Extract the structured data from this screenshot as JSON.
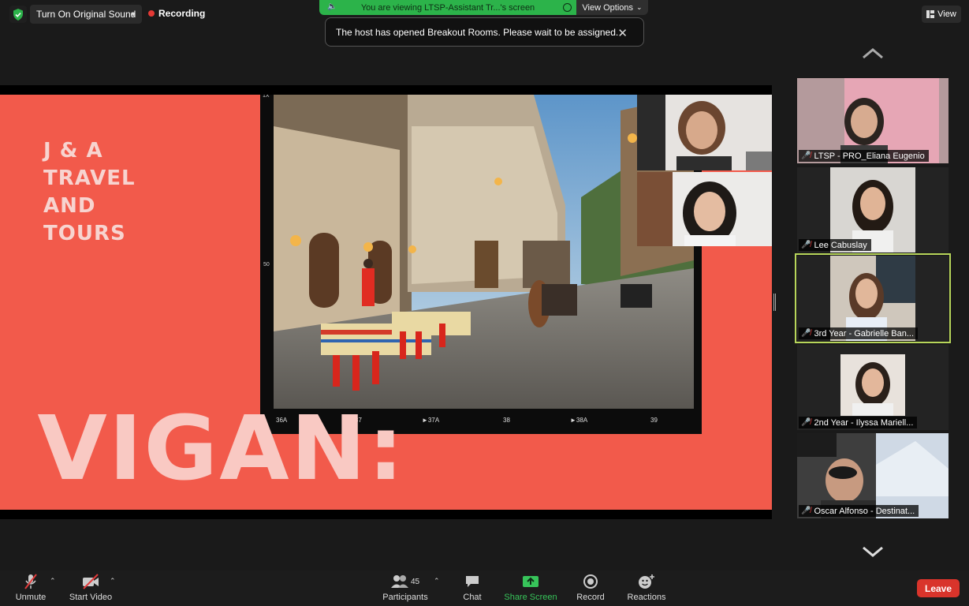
{
  "topbar": {
    "original_sound_label": "Turn On Original Sound",
    "recording_label": "Recording",
    "viewing_text": "You are viewing LTSP-Assistant Tr...'s screen",
    "view_options_label": "View Options",
    "view_label": "View"
  },
  "notification": {
    "text": "The host has opened Breakout Rooms. Please wait to be assigned."
  },
  "slide": {
    "title_lines": [
      "J & A",
      "TRAVEL",
      "AND",
      "TOURS"
    ],
    "big_word": "VIGAN:",
    "film_labels": [
      "36A",
      "37",
      "►37A",
      "38",
      "►38A",
      "39"
    ],
    "side_marks": [
      "1X",
      "50"
    ]
  },
  "participants": [
    {
      "name": "LTSP - PRO_Eliana Eugenio",
      "muted": true,
      "active": false
    },
    {
      "name": "Lee Cabuslay",
      "muted": true,
      "active": false
    },
    {
      "name": "3rd Year - Gabrielle Ban...",
      "muted": true,
      "active": true
    },
    {
      "name": "2nd Year - Ilyssa Mariell...",
      "muted": true,
      "active": false
    },
    {
      "name": "Oscar Alfonso - Destinat...",
      "muted": true,
      "active": false
    }
  ],
  "toolbar": {
    "unmute_label": "Unmute",
    "start_video_label": "Start Video",
    "participants_label": "Participants",
    "participants_count": "45",
    "chat_label": "Chat",
    "share_screen_label": "Share Screen",
    "record_label": "Record",
    "reactions_label": "Reactions",
    "leave_label": "Leave"
  },
  "colors": {
    "slide_bg": "#f25a4b",
    "share_green": "#2cb34a",
    "leave_red": "#d9342b",
    "active_outline": "#b7d55a"
  }
}
